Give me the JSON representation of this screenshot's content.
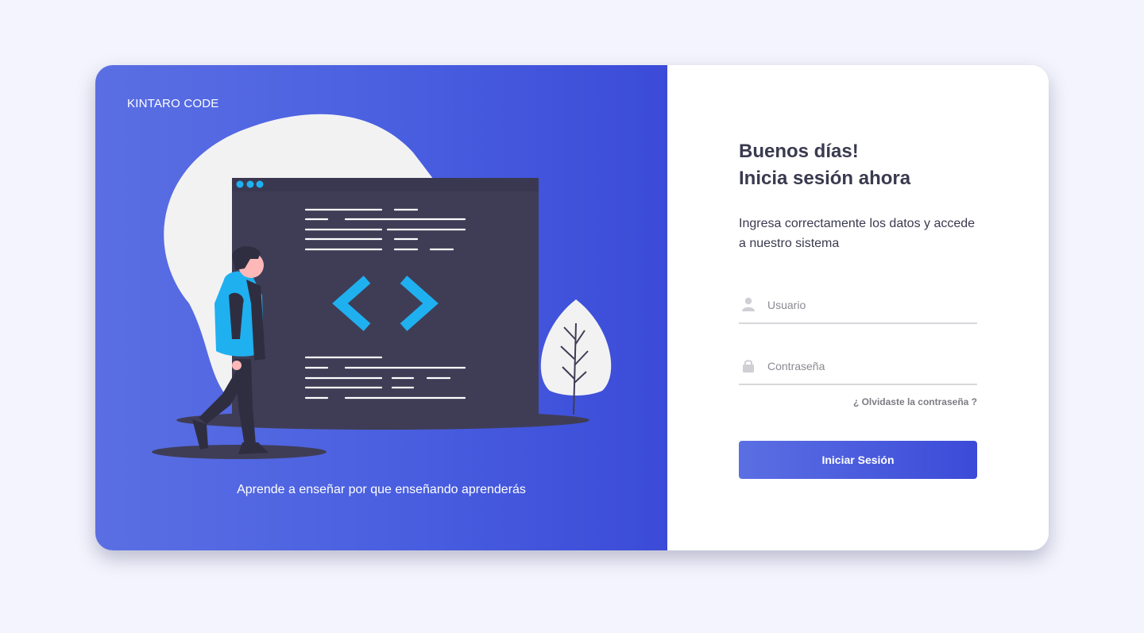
{
  "brand": {
    "name": "KINTARO CODE"
  },
  "hero": {
    "tagline": "Aprende a enseñar por que enseñando aprenderás",
    "illustration": "developer-code-window"
  },
  "login": {
    "greeting_line1": "Buenos días!",
    "greeting_line2": "Inicia sesión ahora",
    "subtitle": "Ingresa correctamente los datos y accede a nuestro sistema",
    "username": {
      "placeholder": "Usuario",
      "value": "",
      "icon": "user-icon"
    },
    "password": {
      "placeholder": "Contraseña",
      "value": "",
      "icon": "lock-icon"
    },
    "forgot_label": "¿ Olvidaste la contraseña ?",
    "submit_label": "Iniciar Sesión"
  },
  "colors": {
    "page_background": "#f3f4fd",
    "gradient_start": "#5b6fe3",
    "gradient_end": "#3b4bd8",
    "heading_text": "#3a3a4f",
    "accent_cyan": "#1fb0f0",
    "window_dark": "#3f3d56"
  }
}
